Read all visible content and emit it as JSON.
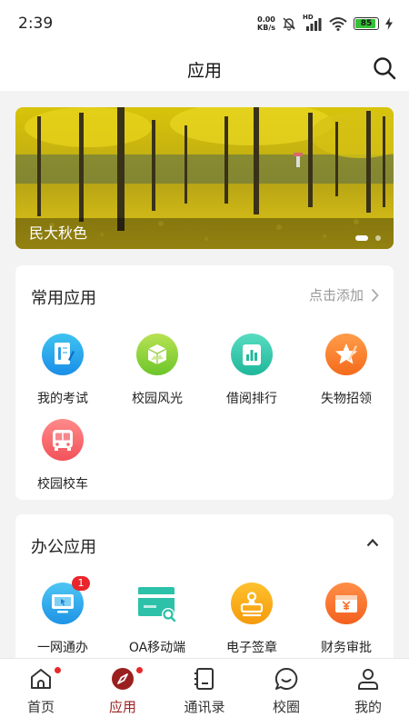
{
  "status_bar": {
    "time": "2:39",
    "net_speed_value": "0.00",
    "net_speed_unit": "KB/s",
    "signal_label": "HD",
    "battery_level": "85"
  },
  "header": {
    "title": "应用"
  },
  "banner": {
    "caption": "民大秋色"
  },
  "common_apps": {
    "title": "常用应用",
    "add_label": "点击添加",
    "items": [
      {
        "label": "我的考试",
        "icon": "exam-icon"
      },
      {
        "label": "校园风光",
        "icon": "campus-scenery-icon"
      },
      {
        "label": "借阅排行",
        "icon": "borrow-ranking-icon"
      },
      {
        "label": "失物招领",
        "icon": "lost-and-found-icon"
      },
      {
        "label": "校园校车",
        "icon": "school-bus-icon"
      }
    ]
  },
  "office_apps": {
    "title": "办公应用",
    "items": [
      {
        "label": "一网通办",
        "icon": "one-stop-service-icon",
        "badge": "1"
      },
      {
        "label": "OA移动端",
        "icon": "oa-mobile-icon"
      },
      {
        "label": "电子签章",
        "icon": "e-seal-icon"
      },
      {
        "label": "财务审批",
        "icon": "finance-approval-icon"
      }
    ]
  },
  "tabs": [
    {
      "label": "首页",
      "icon": "home-icon"
    },
    {
      "label": "应用",
      "icon": "compass-icon"
    },
    {
      "label": "通讯录",
      "icon": "contacts-icon"
    },
    {
      "label": "校圈",
      "icon": "chat-icon"
    },
    {
      "label": "我的",
      "icon": "user-icon"
    }
  ],
  "colors": {
    "accent": "#9b1f1f",
    "badge": "#e9262c",
    "background": "#f3f3f3"
  }
}
